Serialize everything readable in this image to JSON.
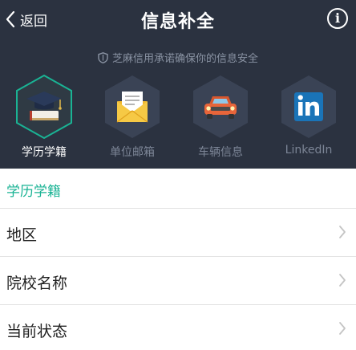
{
  "topbar": {
    "back_label": "返回",
    "title": "信息补全",
    "info_symbol": "i"
  },
  "notice": "芝麻信用承诺确保你的信息安全",
  "categories": [
    {
      "label": "学历学籍",
      "icon": "graduation-cap-icon",
      "active": true
    },
    {
      "label": "单位邮箱",
      "icon": "envelope-icon",
      "active": false
    },
    {
      "label": "车辆信息",
      "icon": "car-icon",
      "active": false
    },
    {
      "label": "LinkedIn",
      "icon": "linkedin-icon",
      "active": false
    }
  ],
  "section_title": "学历学籍",
  "form_rows": [
    {
      "label": "地区"
    },
    {
      "label": "院校名称"
    },
    {
      "label": "当前状态"
    }
  ],
  "colors": {
    "header_bg": "#2b3240",
    "accent": "#1ab394",
    "inactive_hex": "#3a4355"
  }
}
